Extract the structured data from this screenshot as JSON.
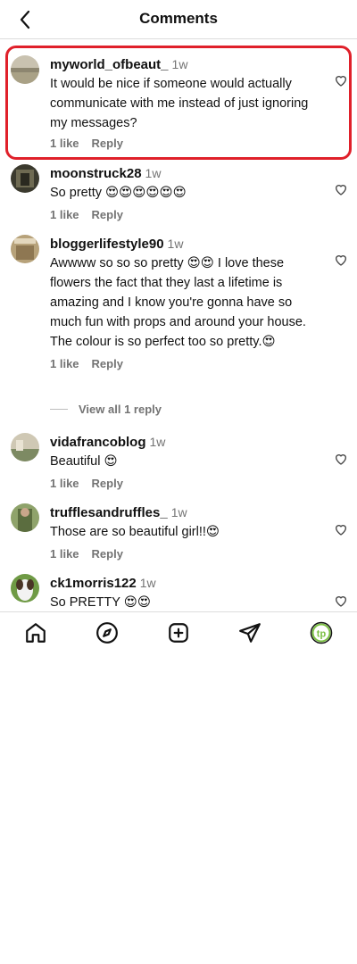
{
  "header": {
    "title": "Comments"
  },
  "comments": [
    {
      "username": "myworld_ofbeaut_",
      "time": "1w",
      "text": "It would be nice if someone would actually communicate with me instead of just ignoring my messages?",
      "likes": "1 like",
      "reply": "Reply"
    },
    {
      "username": "moonstruck28",
      "time": "1w",
      "text": "So pretty 😍😍😍😍😍😍",
      "likes": "1 like",
      "reply": "Reply"
    },
    {
      "username": "bloggerlifestyle90",
      "time": "1w",
      "text": "Awwww so so so pretty 😍😍 I love these flowers the fact that they last a lifetime is amazing and I know you're gonna have so much fun with props and around your house. The colour is so perfect too so pretty.😍",
      "likes": "1 like",
      "reply": "Reply"
    },
    {
      "username": "vidafrancoblog",
      "time": "1w",
      "text": "Beautiful 😍",
      "likes": "1 like",
      "reply": "Reply"
    },
    {
      "username": "trufflesandruffles_",
      "time": "1w",
      "text": "Those are so beautiful girl!!😍",
      "likes": "1 like",
      "reply": "Reply"
    },
    {
      "username": "ck1morris122",
      "time": "1w",
      "text": "So PRETTY 😍😍",
      "likes": "",
      "reply": ""
    }
  ],
  "view_replies": "View all 1 reply",
  "tabbar": {
    "icons": [
      "home-icon",
      "explore-icon",
      "new-post-icon",
      "direct-message-icon",
      "profile-avatar"
    ],
    "profile_initials": "tp",
    "profile_color": "#7bc043"
  },
  "colors": {
    "highlight": "#e0202a",
    "secondary_text": "#737373"
  }
}
